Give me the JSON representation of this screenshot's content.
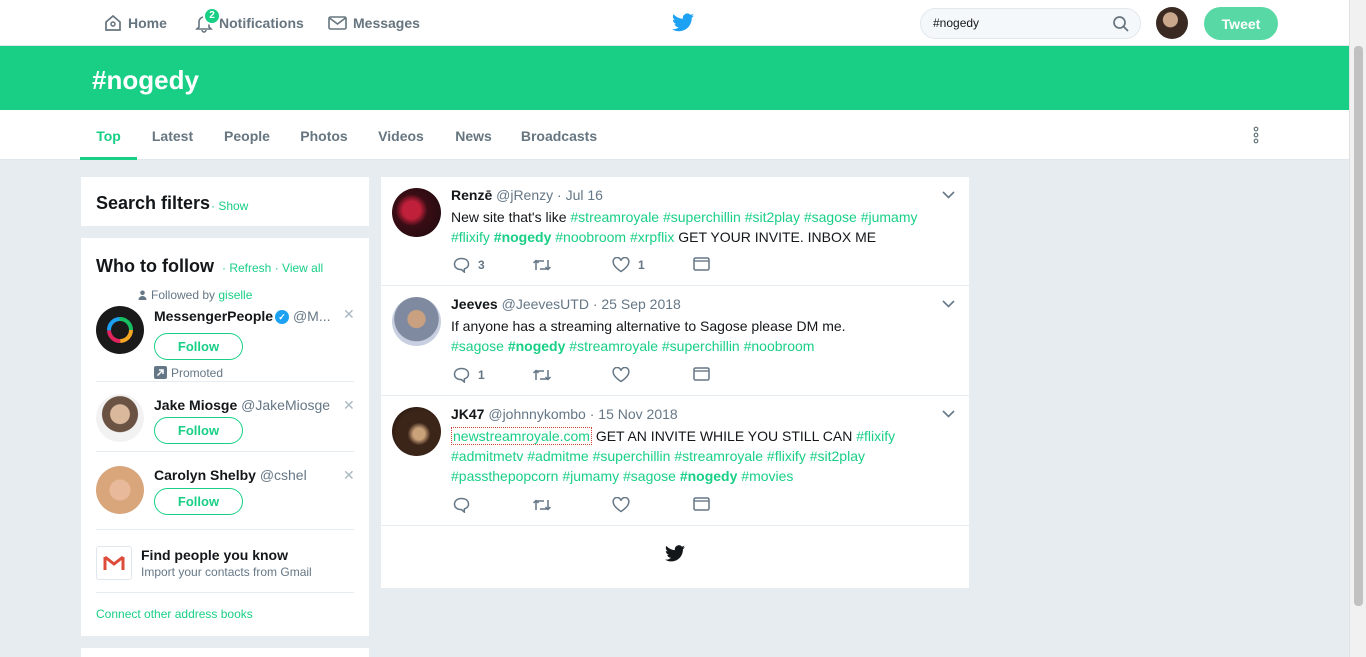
{
  "nav": {
    "home": "Home",
    "notifications": "Notifications",
    "notifications_badge": "2",
    "messages": "Messages",
    "search_value": "#nogedy",
    "tweet_button": "Tweet"
  },
  "search_header": {
    "title": "#nogedy"
  },
  "tabs": [
    {
      "label": "Top",
      "active": true
    },
    {
      "label": "Latest"
    },
    {
      "label": "People"
    },
    {
      "label": "Photos"
    },
    {
      "label": "Videos"
    },
    {
      "label": "News"
    },
    {
      "label": "Broadcasts"
    }
  ],
  "search_filters": {
    "title": "Search filters",
    "show": "· Show"
  },
  "who_to_follow": {
    "title": "Who to follow",
    "refresh": "· Refresh",
    "view_all": "· View all",
    "followed_by_prefix": "Followed by",
    "followed_by_name": "giselle",
    "suggestions": [
      {
        "name": "MessengerPeople",
        "handle": "@M...",
        "follow": "Follow",
        "promoted": "Promoted",
        "verified": true
      },
      {
        "name": "Jake Miosge",
        "handle": "@JakeMiosge",
        "follow": "Follow"
      },
      {
        "name": "Carolyn Shelby",
        "handle": "@cshel",
        "follow": "Follow"
      }
    ],
    "find_people_title": "Find people you know",
    "find_people_sub": "Import your contacts from Gmail",
    "connect_other": "Connect other address books"
  },
  "tweets": [
    {
      "name": "Renzē",
      "handle": "@jRenzy",
      "date": "· Jul 16",
      "text_html": "New site that's like <span class=\"green\">#streamroyale</span> <span class=\"green\">#superchillin</span> <span class=\"green\">#sit2play</span> <span class=\"green\">#sagose</span> <span class=\"green\">#jumamy</span> <span class=\"green\">#flixify</span> <span class=\"hl\">#nogedy</span> <span class=\"green\">#noobroom</span> <span class=\"green\">#xrpflix</span> GET YOUR INVITE. INBOX ME",
      "replies": "3",
      "retweets": "",
      "likes": "1"
    },
    {
      "name": "Jeeves",
      "handle": "@JeevesUTD",
      "date": "· 25 Sep 2018",
      "text_html": "If anyone has a streaming alternative to Sagose please DM me.<br><span class=\"green\">#sagose</span> <span class=\"hl\">#nogedy</span> <span class=\"green\">#streamroyale</span> <span class=\"green\">#superchillin</span> <span class=\"green\">#noobroom</span>",
      "replies": "1",
      "retweets": "",
      "likes": ""
    },
    {
      "name": "JK47",
      "handle": "@johnnykombo",
      "date": "· 15 Nov 2018",
      "text_html": "<span class=\"url\">newstreamroyale.com</span> GET AN INVITE WHILE YOU STILL CAN <span class=\"green\">#flixify</span> <span class=\"green\">#admitmetv</span> <span class=\"green\">#admitme</span> <span class=\"green\">#superchillin</span> <span class=\"green\">#streamroyale</span> <span class=\"green\">#flixify</span> <span class=\"green\">#sit2play</span> <span class=\"green\">#passthepopcorn</span> <span class=\"green\">#jumamy</span> <span class=\"green\">#sagose</span> <span class=\"hl\">#nogedy</span> <span class=\"green\">#movies</span>",
      "replies": "",
      "retweets": "",
      "likes": ""
    }
  ],
  "colors": {
    "brand": "#19cf86",
    "tweet_button": "#58d8a5",
    "text_muted": "#657786"
  }
}
